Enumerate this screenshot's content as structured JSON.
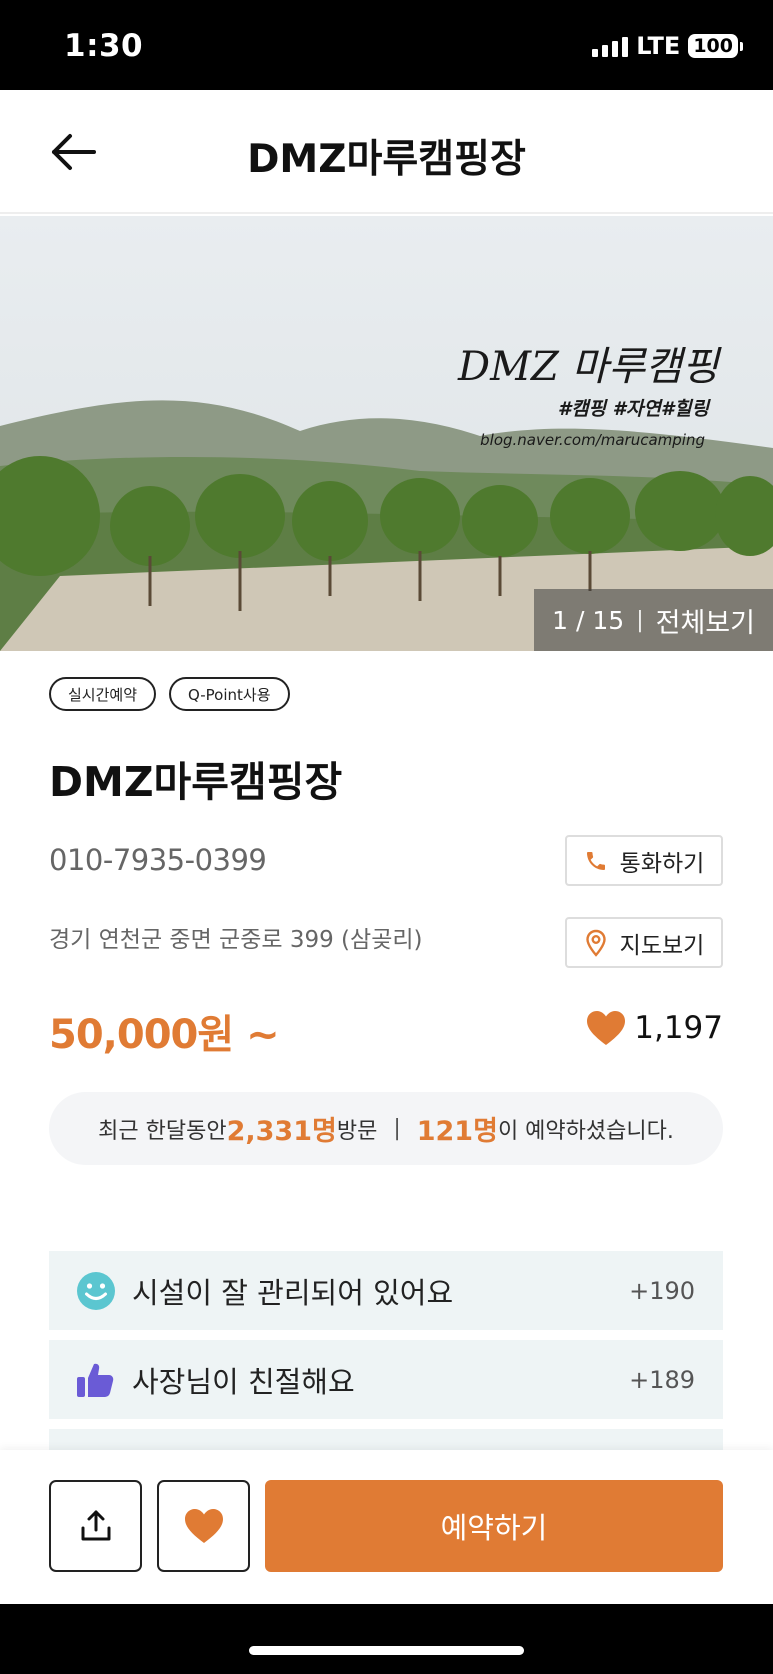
{
  "status_bar": {
    "time": "1:30",
    "network": "LTE",
    "battery": "100"
  },
  "header": {
    "title": "DMZ마루캠핑장",
    "back_icon": "arrow-left-icon"
  },
  "gallery": {
    "image_brand_text": "DMZ 마루캠핑",
    "image_tags_text": "#캠핑 #자연#힐링",
    "image_url_text": "blog.naver.com/marucamping",
    "counter": "1 / 15",
    "view_all_label": "전체보기"
  },
  "chips": [
    "실시간예약",
    "Q-Point사용"
  ],
  "place": {
    "name": "DMZ마루캠핑장",
    "phone": "010-7935-0399",
    "address": "경기 연천군 중면 군중로 399 (삼곶리)",
    "call_label": "통화하기",
    "map_label": "지도보기",
    "price": "50,000원 ~",
    "likes": "1,197"
  },
  "visit_banner": {
    "prefix": "최근 한달동안 ",
    "visitors": "2,331명",
    "visit_word": "방문",
    "separator": "|",
    "reservations": "121명",
    "suffix": "이 예약하셨습니다."
  },
  "reviews": [
    {
      "icon": "smiley-icon",
      "text": "시설이 잘 관리되어 있어요",
      "count": "+190"
    },
    {
      "icon": "thumbs-up-icon",
      "text": "사장님이 친절해요",
      "count": "+189"
    }
  ],
  "bottom_bar": {
    "share_icon": "share-icon",
    "favorite_icon": "heart-icon",
    "reserve_label": "예약하기"
  },
  "colors": {
    "accent": "#e07b34",
    "review_bg": "#eef4f5",
    "banner_bg": "#f4f5f7"
  }
}
